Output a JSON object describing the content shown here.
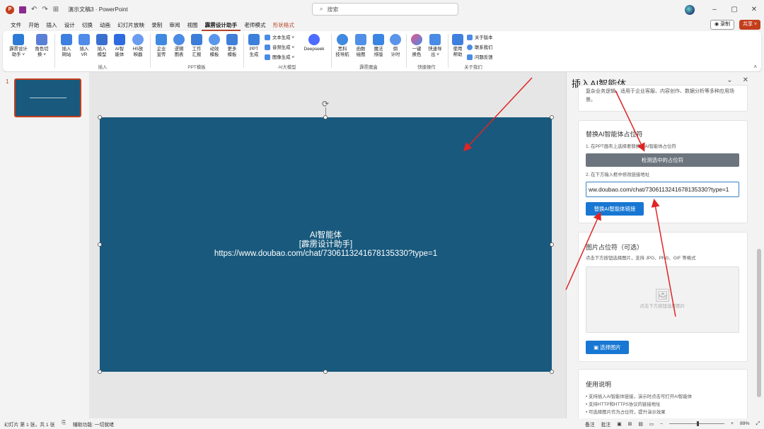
{
  "titlebar": {
    "doc_title": "演示文稿3  ·  PowerPoint",
    "search_placeholder": "搜索",
    "win_minimize": "–",
    "win_restore": "▢",
    "win_close": "✕"
  },
  "menu": {
    "tabs": [
      "文件",
      "开始",
      "插入",
      "设计",
      "切换",
      "动画",
      "幻灯片放映",
      "录制",
      "审阅",
      "视图",
      "霹雳设计助手",
      "老师模式",
      "形状格式"
    ],
    "record_label": "◉ 录制",
    "share_label": "共享 ˅"
  },
  "ribbon": {
    "items": {
      "i0": "霹雳设计\n助手 ˅",
      "i1": "角色切\n换 ˅",
      "i2": "插入\n网站",
      "i3": "插入\nVR",
      "i4": "插入\n模型",
      "i5": "AI智\n能体",
      "i6": "H5放\n映器",
      "i7": "企业\n宣传",
      "i8": "逻辑\n图表",
      "i9": "工作\n汇报",
      "i10": "动效\n模板",
      "i11": "更多\n模板",
      "i12": "PPT\n生成",
      "i13": "Deepseek",
      "i14": "黑科\n技导航",
      "i15": "函数\n绘图",
      "i16": "魔法\n排版",
      "i17": "倒\n计时",
      "i18": "一键\n换色",
      "i19": "快速导\n出 ˅",
      "i20": "使用\n帮助"
    },
    "small": {
      "text_gen": "文本生成 ˅",
      "audio_gen": "音频生成 ˅",
      "image_gen": "图像生成 ˅",
      "about_ver": "关于版本",
      "contact": "联系我们",
      "feedback": "问题反馈"
    },
    "groups": {
      "insert": "插入",
      "ppt_template": "PPT模板",
      "ai_model": "AI大模型",
      "magic_box": "霹雳魔盒",
      "quick_ops": "快捷操作",
      "about_us": "关于我们"
    }
  },
  "thumbnails": {
    "slide_number": "1"
  },
  "slide": {
    "line1": "AI智能体",
    "line2": "[霹雳设计助手]",
    "line3": "https://www.doubao.com/chat/7306113241678135330?type=1"
  },
  "taskpane": {
    "title": "插入AI智能体",
    "top_desc": "复杂业务逻辑。适用于企业客服、内容创作、数据分析等多种应用场景。",
    "replace": {
      "heading": "替换AI智能体占位符",
      "step1": "1. 在PPT画布上选择要替换的AI智能体占位符",
      "detect_btn": "检测选中的占位符",
      "step2": "2. 在下方输入框中修改链接地址",
      "url_value": "ww.doubao.com/chat/7306113241678135330?type=1",
      "replace_btn": "替换AI智能体链接"
    },
    "image": {
      "heading": "图片占位符（可选）",
      "desc": "点击下方按钮选择图片，支持 JPG、PNG、GIF 等格式",
      "drop_text": "点击下方按钮选择图片",
      "select_btn": "选择图片"
    },
    "usage": {
      "heading": "使用说明",
      "items": [
        "• 支持插入AI智能体链接，演示时点击可打开AI智能体",
        "• 支持HTTP和HTTPS协议的链接地址",
        "• 可选择图片作为占位符，提升演示效果"
      ]
    }
  },
  "statusbar": {
    "slide_info": "幻灯片 第 1 张，共 1 张",
    "accessibility": "辅助功能: 一切就绪",
    "notes": "备注",
    "comments": "批注",
    "zoom": "89%"
  },
  "colors": {
    "slide_bg": "#18597d",
    "accent": "#c43e1c",
    "primary_btn": "#1877d2",
    "annotation_arrow": "#e02424"
  }
}
